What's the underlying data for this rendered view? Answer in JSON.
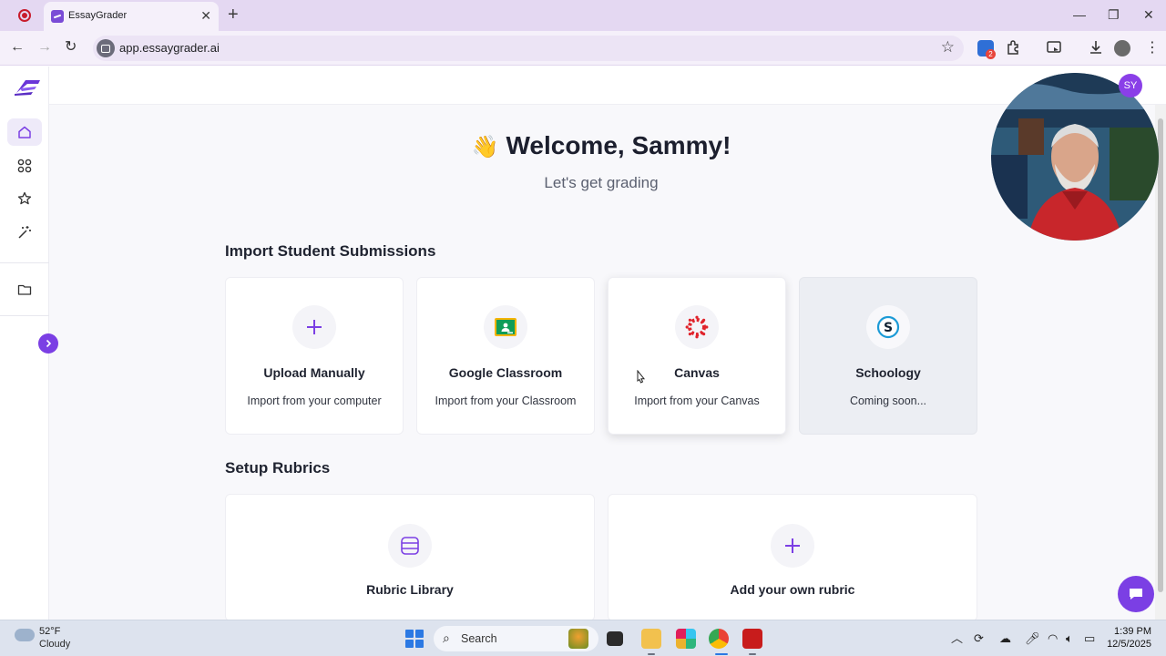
{
  "browser": {
    "tab_title": "EssayGrader",
    "url": "app.essaygrader.ai",
    "extension_badge_count": "2",
    "icons": [
      "record-icon",
      "close-icon",
      "plus-icon",
      "back-icon",
      "forward-icon",
      "reload-icon",
      "site-info-icon",
      "bookmark-star-icon",
      "extension-icon",
      "puzzle-icon",
      "media-icon",
      "download-icon",
      "profile-icon",
      "menu-icon"
    ]
  },
  "app": {
    "user_initials": "SY",
    "welcome": "Welcome, Sammy!",
    "subtitle": "Let's get grading",
    "accent_color": "#7b3fe4",
    "import_section": {
      "title": "Import Student Submissions",
      "cards": [
        {
          "title": "Upload Manually",
          "subtitle": "Import from your computer",
          "icon": "plus-icon"
        },
        {
          "title": "Google Classroom",
          "subtitle": "Import from your Classroom",
          "icon": "google-classroom-icon"
        },
        {
          "title": "Canvas",
          "subtitle": "Import from your Canvas",
          "icon": "canvas-icon"
        },
        {
          "title": "Schoology",
          "subtitle": "Coming soon...",
          "icon": "schoology-icon"
        }
      ]
    },
    "rubrics_section": {
      "title": "Setup Rubrics",
      "cards": [
        {
          "title": "Rubric Library",
          "icon": "rubric-library-icon"
        },
        {
          "title": "Add your own rubric",
          "icon": "plus-icon"
        }
      ]
    },
    "sidebar_icons": [
      "home-icon",
      "grid-icon",
      "star-icon",
      "magic-wand-icon",
      "folder-icon"
    ]
  },
  "taskbar": {
    "temperature": "52°F",
    "weather": "Cloudy",
    "search_placeholder": "Search",
    "time": "1:39 PM",
    "date": "12/5/2025"
  }
}
